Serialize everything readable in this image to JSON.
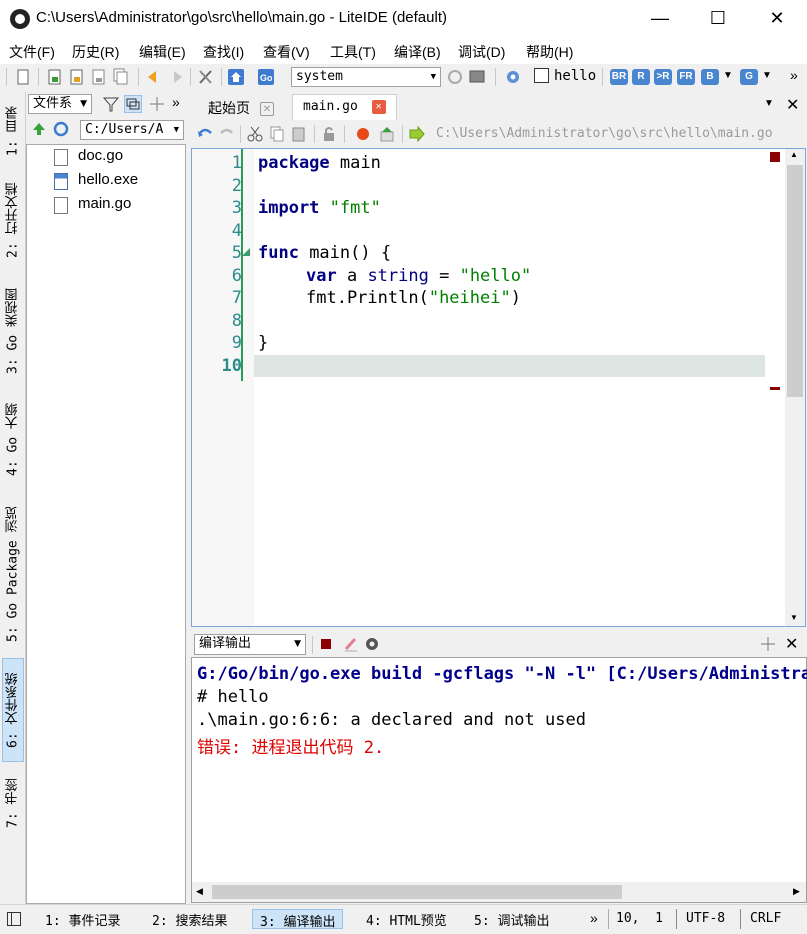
{
  "window": {
    "title": "C:\\Users\\Administrator\\go\\src\\hello\\main.go - LiteIDE (default)",
    "minimize": "—",
    "maximize": "☐",
    "close": "✕"
  },
  "menu": [
    "文件(F)",
    "历史(R)",
    "编辑(E)",
    "查找(I)",
    "查看(V)",
    "工具(T)",
    "编译(B)",
    "调试(D)",
    "帮助(H)"
  ],
  "toolbar": {
    "env_select": "system",
    "target_label": "hello",
    "build_buttons": [
      "BR",
      "R",
      ">R",
      "FR",
      "B",
      "G"
    ],
    "overflow": "»"
  },
  "left_tabs": [
    "1: 目录",
    "2: 打开文档",
    "3: Go 类视图",
    "4: Go 大纲",
    "5: Go Package 浏览",
    "6: 文件系统",
    "7: 书签"
  ],
  "file_panel": {
    "view_select": "文件系",
    "path_select": "C:/Users/A",
    "overflow": "»",
    "files": [
      {
        "name": "doc.go",
        "icon": "go-file-icon"
      },
      {
        "name": "hello.exe",
        "icon": "exe-file-icon"
      },
      {
        "name": "main.go",
        "icon": "go-file-icon"
      }
    ]
  },
  "editor_tabs": [
    {
      "label": "起始页"
    },
    {
      "label": "main.go"
    }
  ],
  "editor_path": "C:\\Users\\Administrator\\go\\src\\hello\\main.go",
  "editor": {
    "line_numbers": [
      "1",
      "2",
      "3",
      "4",
      "5",
      "6",
      "7",
      "8",
      "9",
      "10"
    ],
    "current_line": "10",
    "code": {
      "l1_kw": "package",
      "l1_rest": " main",
      "l3_kw": "import",
      "l3_str": "\"fmt\"",
      "l5_kw": "func",
      "l5_rest": " main() {",
      "l6_kw": "var",
      "l6_a": " a ",
      "l6_ty": "string",
      "l6_eq": " = ",
      "l6_str": "\"hello\"",
      "l7_call": "fmt.Println(",
      "l7_str": "\"heihei\"",
      "l7_end": ")",
      "l9": "}"
    }
  },
  "output": {
    "select": "编译输出",
    "lines": [
      {
        "text": "G:/Go/bin/go.exe build -gcflags \"-N -l\" [C:/Users/Administrator/go/src/hello]",
        "color": "#00008b"
      },
      {
        "text": "# hello",
        "color": "#000000"
      },
      {
        "text": ".\\main.go:6:6: a declared and not used",
        "color": "#000000"
      },
      {
        "text": "错误: 进程退出代码 2.",
        "color": "#e00000"
      }
    ]
  },
  "status_tabs": [
    "1: 事件记录",
    "2: 搜索结果",
    "3: 编译输出",
    "4: HTML预览",
    "5: 调试输出"
  ],
  "status": {
    "overflow": "»",
    "position": "10,  1",
    "encoding": "UTF-8",
    "line_ending": "CRLF"
  },
  "colors": {
    "accent": "#99c0e6",
    "keyword": "#000080",
    "string": "#008000",
    "line_number": "#2e8b8b",
    "error": "#e00000"
  }
}
